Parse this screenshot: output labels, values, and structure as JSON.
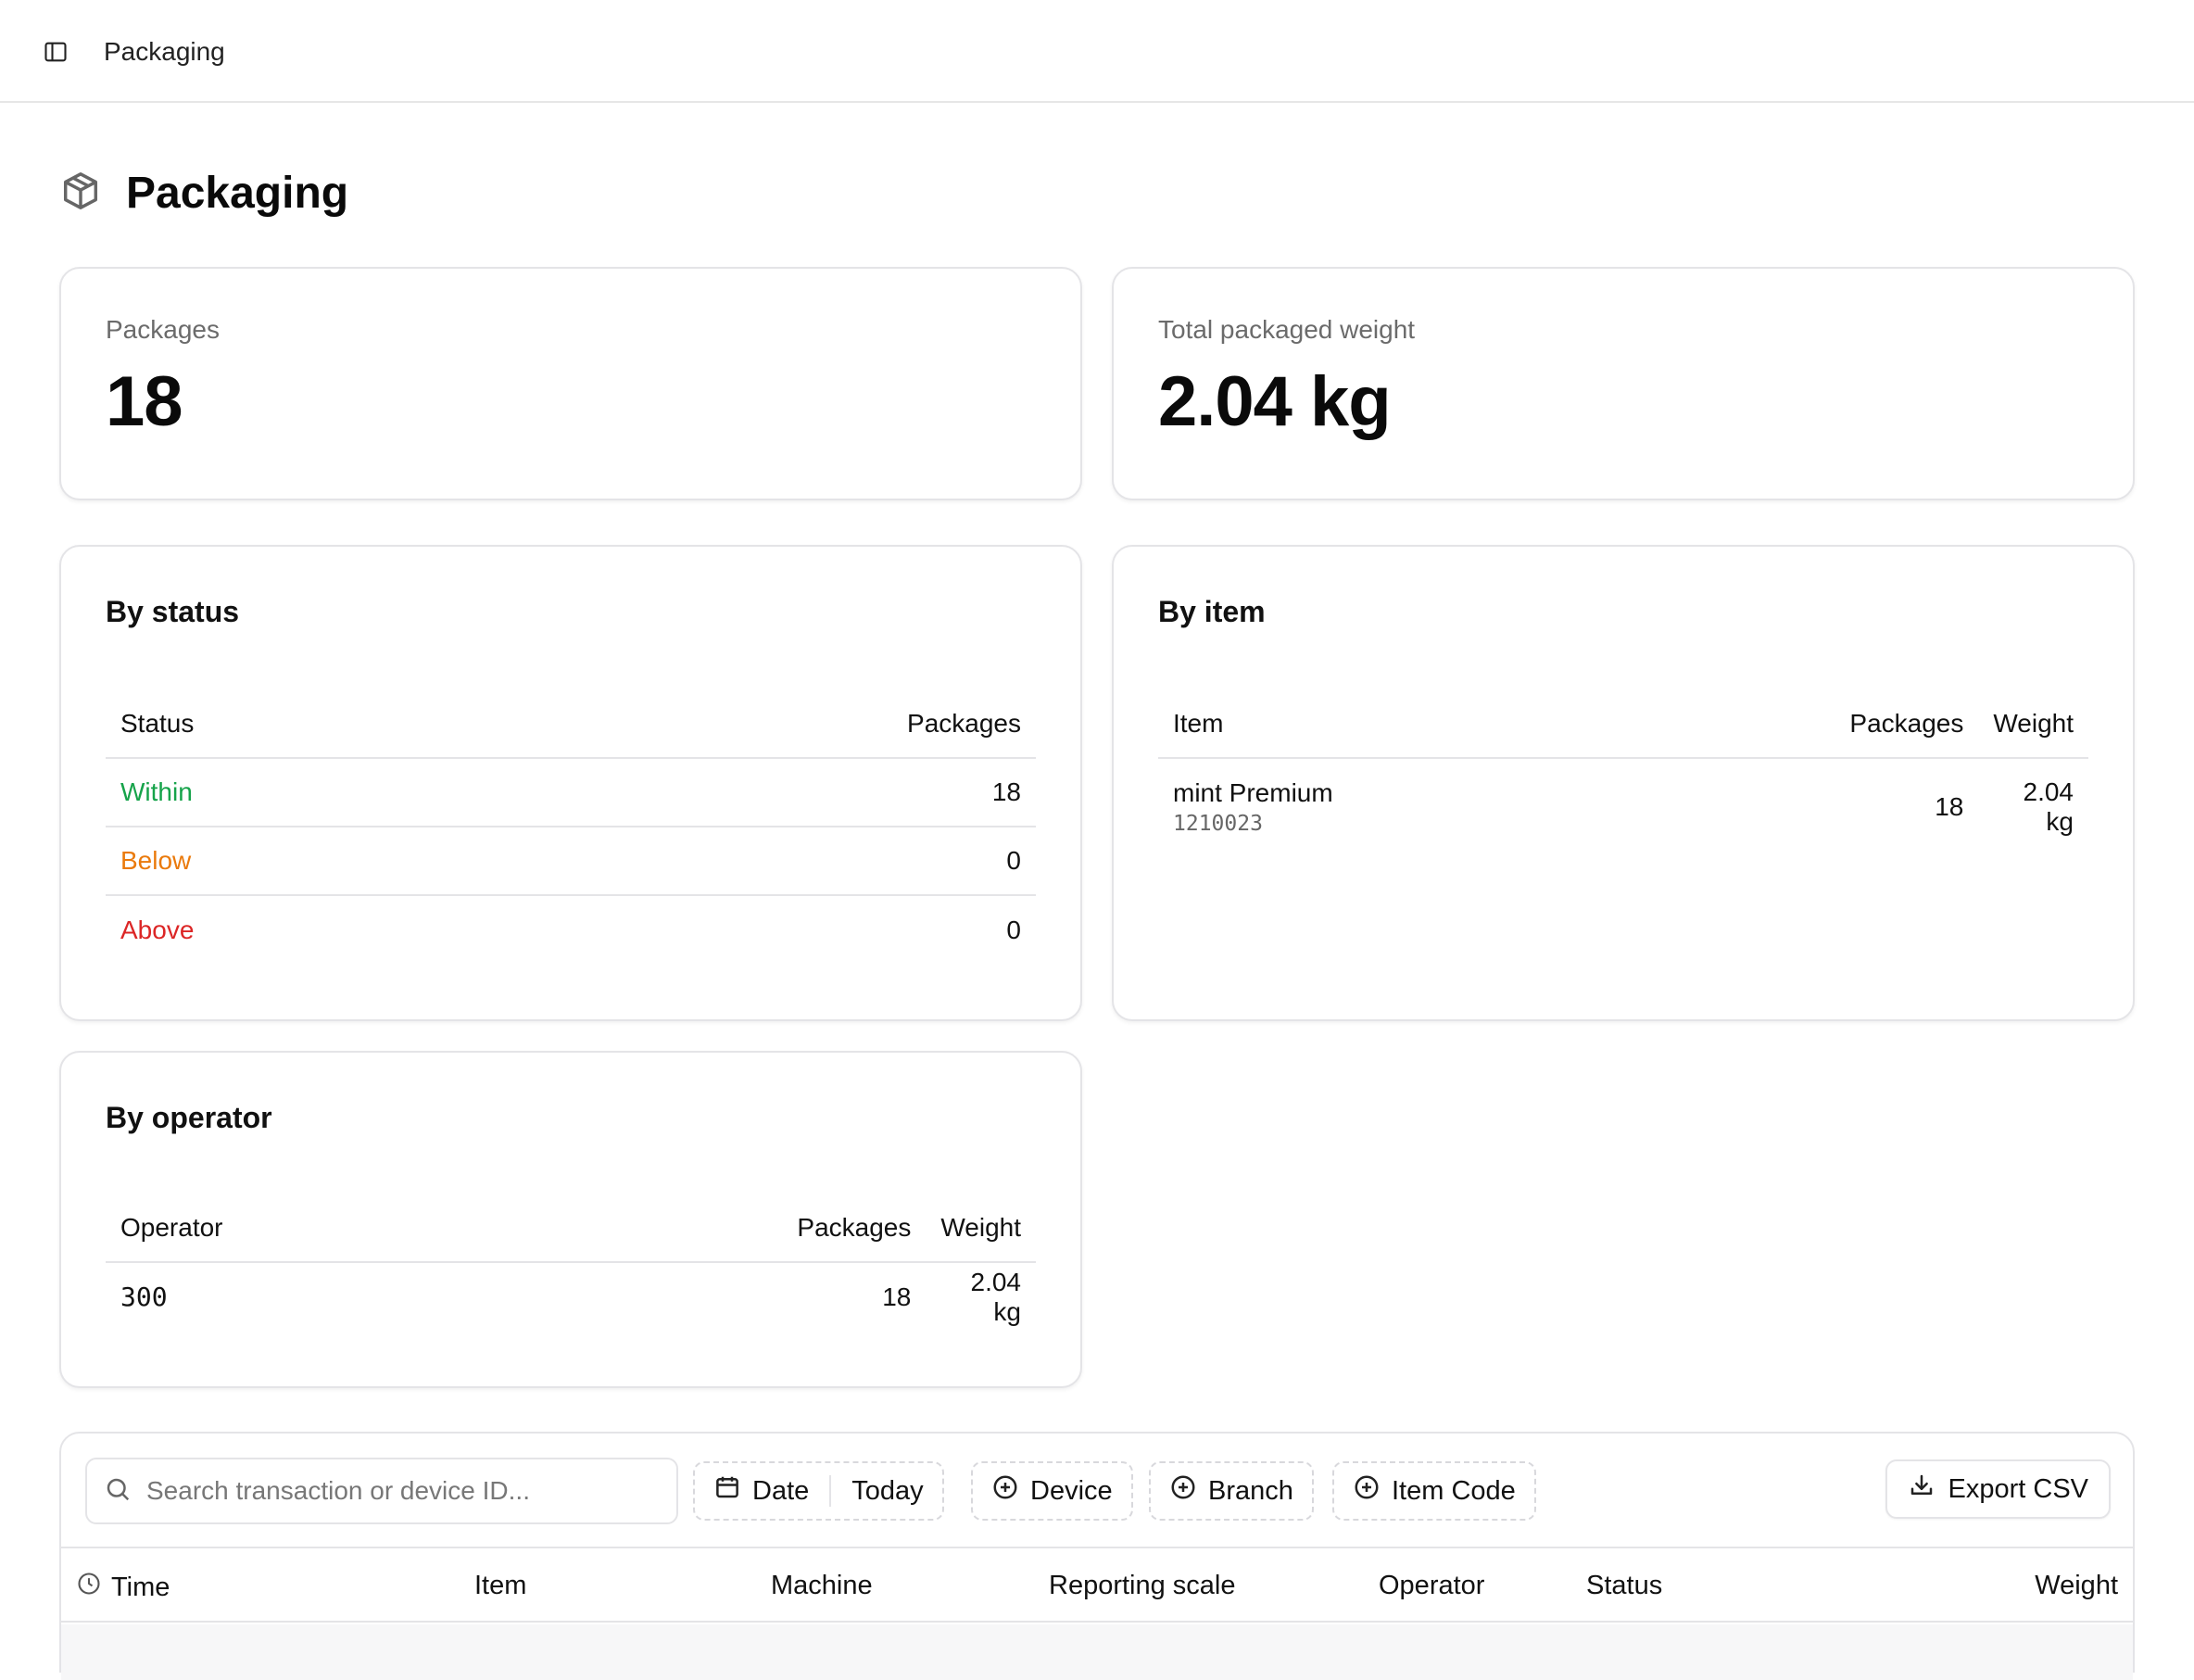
{
  "topbar": {
    "breadcrumb": "Packaging"
  },
  "page": {
    "title": "Packaging"
  },
  "stats": {
    "packages": {
      "label": "Packages",
      "value": "18"
    },
    "weight": {
      "label": "Total packaged weight",
      "value": "2.04 kg"
    }
  },
  "by_status": {
    "title": "By status",
    "columns": [
      "Status",
      "Packages"
    ],
    "rows": [
      {
        "status": "Within",
        "packages": "18",
        "color": "#16a34a"
      },
      {
        "status": "Below",
        "packages": "0",
        "color": "#ea7a0c"
      },
      {
        "status": "Above",
        "packages": "0",
        "color": "#dc2626"
      }
    ]
  },
  "by_item": {
    "title": "By item",
    "columns": [
      "Item",
      "Packages",
      "Weight"
    ],
    "rows": [
      {
        "name": "mint Premium",
        "code": "1210023",
        "packages": "18",
        "weight": "2.04 kg"
      }
    ]
  },
  "by_operator": {
    "title": "By operator",
    "columns": [
      "Operator",
      "Packages",
      "Weight"
    ],
    "rows": [
      {
        "operator": "300",
        "packages": "18",
        "weight": "2.04 kg"
      }
    ]
  },
  "toolbar": {
    "search_placeholder": "Search transaction or device ID...",
    "date_label": "Date",
    "date_value": "Today",
    "device_label": "Device",
    "branch_label": "Branch",
    "item_code_label": "Item Code",
    "export_label": "Export CSV"
  },
  "transactions": {
    "columns": [
      "Time",
      "Item",
      "Machine",
      "Reporting scale",
      "Operator",
      "Status",
      "Weight"
    ]
  }
}
